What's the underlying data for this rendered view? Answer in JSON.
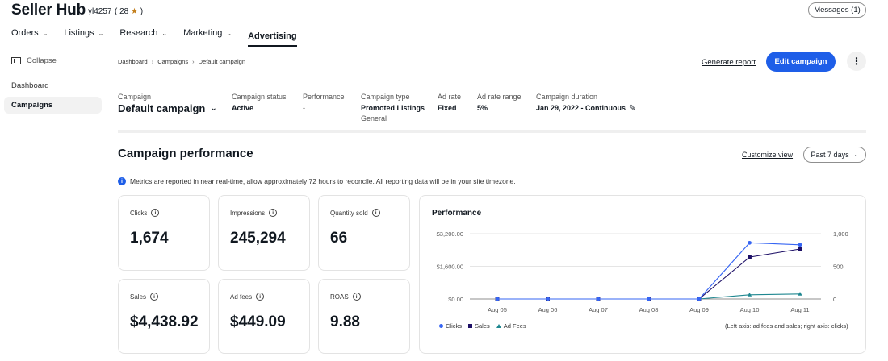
{
  "header": {
    "brand": "Seller Hub",
    "username": "yl4257",
    "rating_open": "(",
    "rating_count": "28",
    "rating_star": "★",
    "rating_close": ")",
    "messages_label": "Messages (1)"
  },
  "topnav": [
    {
      "label": "Orders",
      "has_menu": true
    },
    {
      "label": "Listings",
      "has_menu": true
    },
    {
      "label": "Research",
      "has_menu": true
    },
    {
      "label": "Marketing",
      "has_menu": true
    },
    {
      "label": "Advertising",
      "has_menu": false,
      "active": true
    }
  ],
  "sidebar": {
    "collapse_label": "Collapse",
    "items": [
      {
        "label": "Dashboard"
      },
      {
        "label": "Campaigns",
        "active": true
      }
    ]
  },
  "breadcrumb": [
    "Dashboard",
    "Campaigns",
    "Default campaign"
  ],
  "actions": {
    "generate_report": "Generate report",
    "edit_campaign": "Edit campaign",
    "more": "⋮"
  },
  "campaign": {
    "name_label": "Campaign",
    "name": "Default campaign",
    "status_label": "Campaign status",
    "status": "Active",
    "performance_label": "Performance",
    "performance": "-",
    "type_label": "Campaign type",
    "type": "Promoted Listings",
    "type_sub": "General",
    "ad_rate_label": "Ad rate",
    "ad_rate": "Fixed",
    "ad_rate_range_label": "Ad rate range",
    "ad_rate_range": "5%",
    "duration_label": "Campaign duration",
    "duration": "Jan 29, 2022 - Continuous"
  },
  "performance": {
    "title": "Campaign performance",
    "customize": "Customize view",
    "period": "Past 7 days",
    "notice": "Metrics are reported in near real-time, allow approximately 72 hours to reconcile. All reporting data will be in your site timezone.",
    "metrics": {
      "clicks": {
        "label": "Clicks",
        "value": "1,674"
      },
      "impressions": {
        "label": "Impressions",
        "value": "245,294"
      },
      "quantity_sold": {
        "label": "Quantity sold",
        "value": "66"
      },
      "sales": {
        "label": "Sales",
        "value": "$4,438.92"
      },
      "ad_fees": {
        "label": "Ad fees",
        "value": "$449.09"
      },
      "roas": {
        "label": "ROAS",
        "value": "9.88"
      }
    },
    "chart_title": "Performance",
    "axis_note": "(Left axis: ad fees and sales; right axis: clicks)"
  },
  "chart_data": {
    "type": "line",
    "title": "Performance",
    "categories": [
      "Aug 05",
      "Aug 06",
      "Aug 07",
      "Aug 08",
      "Aug 09",
      "Aug 10",
      "Aug 11"
    ],
    "left_axis": {
      "ticks": [
        "$0.00",
        "$1,600.00",
        "$3,200.00"
      ],
      "tick_values": [
        0,
        1600,
        3200
      ],
      "range": [
        0,
        3200
      ]
    },
    "right_axis": {
      "ticks": [
        "0",
        "500",
        "1,000"
      ],
      "tick_values": [
        0,
        500,
        1000
      ],
      "range": [
        0,
        1000
      ]
    },
    "series": [
      {
        "name": "Clicks",
        "axis": "right",
        "marker": "circle",
        "color": "#3665f3",
        "values": [
          0,
          0,
          0,
          0,
          0,
          860,
          830
        ]
      },
      {
        "name": "Sales",
        "axis": "left",
        "marker": "square",
        "color": "#1d0f66",
        "values": [
          0,
          0,
          0,
          0,
          0,
          2050,
          2450
        ]
      },
      {
        "name": "Ad Fees",
        "axis": "left",
        "marker": "triangle",
        "color": "#1f8790",
        "values": [
          0,
          0,
          0,
          0,
          0,
          205,
          245
        ]
      }
    ],
    "grid": true,
    "legend": "bottom-left"
  }
}
